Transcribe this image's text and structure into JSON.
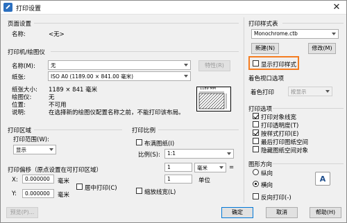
{
  "window": {
    "title": "打印设置",
    "close_glyph": "✕"
  },
  "page_setup": {
    "section": "页面设置",
    "name_label": "名称:",
    "name_value": "<无>"
  },
  "printer": {
    "section": "打印机/绘图仪",
    "name_label": "名称(M):",
    "name_value": "无",
    "properties_button": "特性(R)",
    "paper_label": "纸张:",
    "paper_value": "ISO A0 (1189.00 × 841.00 毫米)",
    "paper_size_label": "纸张大小:",
    "paper_size_value": "1189 × 841  毫米",
    "plotter_label": "绘图仪:",
    "plotter_value": "无",
    "location_label": "位置:",
    "location_value": "不可用",
    "desc_label": "说明:",
    "desc_value": "在选择新的绘图仪配置名称之前，不能打印该布局。",
    "preview_dim_top": "1189 MM",
    "preview_dim_side": "841 MM"
  },
  "plot_area": {
    "section": "打印区域",
    "range_label": "打印范围(W):",
    "range_value": "显示"
  },
  "plot_offset": {
    "section": "打印偏移（原点设置在可打印区域）",
    "x_label": "X:",
    "x_value": "0.000000",
    "x_unit": "毫米",
    "y_label": "Y:",
    "y_value": "0.000000",
    "y_unit": "毫米",
    "center_label": "居中打印(C)"
  },
  "plot_scale": {
    "section": "打印比例",
    "fit_label": "布满图纸(I)",
    "ratio_label": "比例(S):",
    "ratio_value": "1:1",
    "top_value": "1",
    "top_unit": "毫米",
    "eq": "=",
    "bottom_value": "1",
    "bottom_unit": "单位",
    "lineweight_label": "缩放线宽(L)"
  },
  "style_table": {
    "section": "打印样式表",
    "value": "Monochrome.ctb",
    "new_button": "新建(N)",
    "edit_button": "修改(M)",
    "show_label": "显示打印样式"
  },
  "shaded": {
    "section": "着色视口选项",
    "label": "着色打印",
    "value": "按显示"
  },
  "options": {
    "section": "打印选项",
    "items": [
      {
        "label": "打印对象线宽",
        "checked": true
      },
      {
        "label": "打印透明度(T)",
        "checked": false
      },
      {
        "label": "按样式打印(E)",
        "checked": true
      },
      {
        "label": "最后打印图纸空间",
        "checked": false
      },
      {
        "label": "隐藏图纸空间对象",
        "checked": false
      }
    ]
  },
  "orientation": {
    "section": "图形方向",
    "portrait": "纵向",
    "landscape": "横向",
    "reverse": "反向打印(-)",
    "icon_glyph": "A"
  },
  "footer": {
    "preview": "预览(P)...",
    "ok": "确定",
    "cancel": "取消",
    "help": "帮助(H)"
  }
}
